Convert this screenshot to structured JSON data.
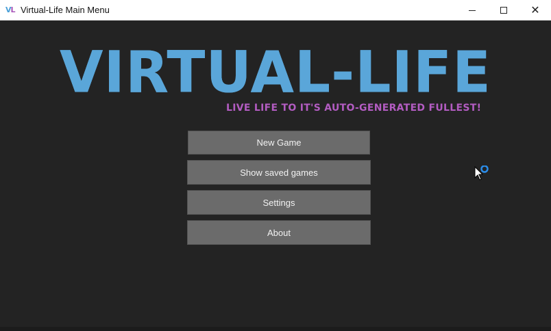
{
  "window": {
    "title": "Virtual-Life Main Menu",
    "icon_letters": {
      "first": "V",
      "second": "L"
    }
  },
  "controls": {
    "minimize_icon": "minimize-icon",
    "maximize_icon": "maximize-icon",
    "close_icon": "close-icon",
    "close_glyph": "✕"
  },
  "logo": {
    "title": "VIRTUAL-LIFE",
    "tagline": "LIVE LIFE TO IT'S AUTO-GENERATED FULLEST!"
  },
  "menu": {
    "new_game": "New Game",
    "show_saved": "Show saved games",
    "settings": "Settings",
    "about": "About"
  },
  "colors": {
    "background": "#232323",
    "logo": "#5aa6d9",
    "tagline": "#b35cc2",
    "button": "#6b6b6b",
    "button_text": "#f2f2f2"
  }
}
